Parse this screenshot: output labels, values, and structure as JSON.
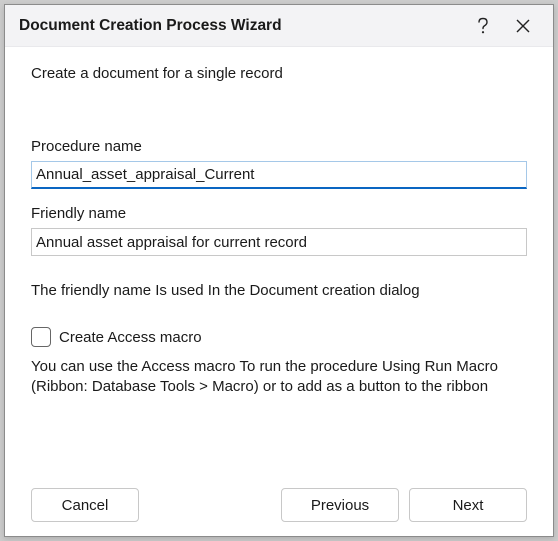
{
  "titlebar": {
    "title": "Document Creation Process Wizard"
  },
  "subtitle": "Create a document for a single record",
  "fields": {
    "procedure": {
      "label": "Procedure name",
      "value": "Annual_asset_appraisal_Current"
    },
    "friendly": {
      "label": "Friendly name",
      "value": "Annual asset appraisal for current record"
    }
  },
  "friendly_help": "The friendly name Is used In the Document creation dialog",
  "macro": {
    "checkbox_label": "Create Access macro",
    "checked": false,
    "help": "You can use the Access macro To run the procedure Using Run Macro (Ribbon: Database Tools > Macro) or to add as a button to the ribbon"
  },
  "buttons": {
    "cancel": "Cancel",
    "previous": "Previous",
    "next": "Next"
  }
}
